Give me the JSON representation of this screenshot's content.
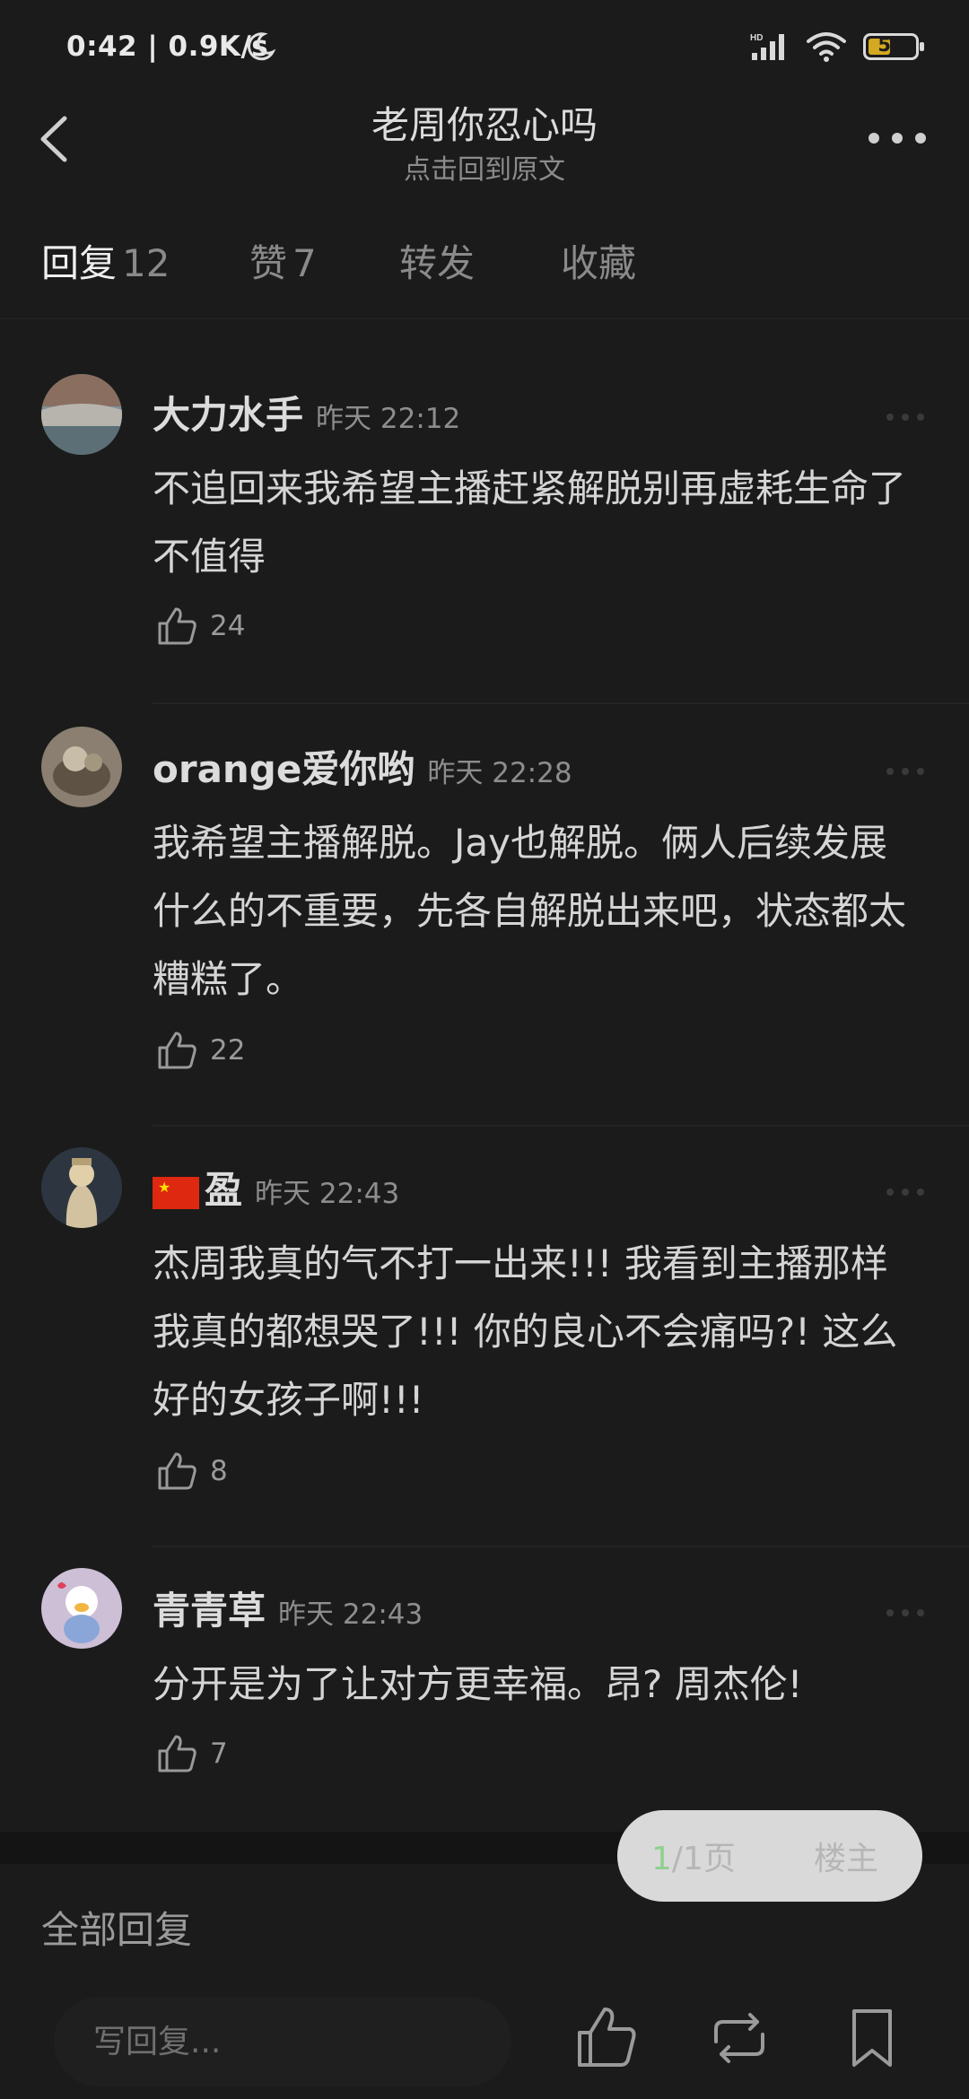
{
  "status": {
    "time_speed": "0:42 | 0.9K/s",
    "hd": "HD",
    "battery": "51"
  },
  "header": {
    "title": "老周你忍心吗",
    "subtitle": "点击回到原文"
  },
  "tabs": [
    {
      "label": "回复",
      "count": "12"
    },
    {
      "label": "赞",
      "count": "7"
    },
    {
      "label": "转发",
      "count": ""
    },
    {
      "label": "收藏",
      "count": ""
    }
  ],
  "comments": [
    {
      "name": "大力水手",
      "time": "昨天 22:12",
      "text": "不追回来我希望主播赶紧解脱别再虚耗生命了 不值得",
      "likes": "24"
    },
    {
      "name": "orange爱你哟",
      "time": "昨天 22:28",
      "text": "我希望主播解脱。Jay也解脱。俩人后续发展什么的不重要，先各自解脱出来吧，状态都太糟糕了。",
      "likes": "22"
    },
    {
      "name": "盈",
      "time": "昨天 22:43",
      "text": "杰周我真的气不打一出来!!! 我看到主播那样我真的都想哭了!!! 你的良心不会痛吗?! 这么好的女孩子啊!!!",
      "likes": "8"
    },
    {
      "name": "青青草",
      "time": "昨天 22:43",
      "text": "分开是为了让对方更幸福。昂? 周杰伦!",
      "likes": "7"
    }
  ],
  "pager": {
    "current": "1",
    "rest": "/1页",
    "owner": "楼主"
  },
  "footer": {
    "section_title": "全部回复",
    "reply_placeholder": "写回复..."
  },
  "colors": {
    "background": "#1b1b1b",
    "text": "#d5d5d5",
    "muted": "#8d8d8d",
    "battery": "#d4a820",
    "pager_current": "#8fd18f"
  }
}
